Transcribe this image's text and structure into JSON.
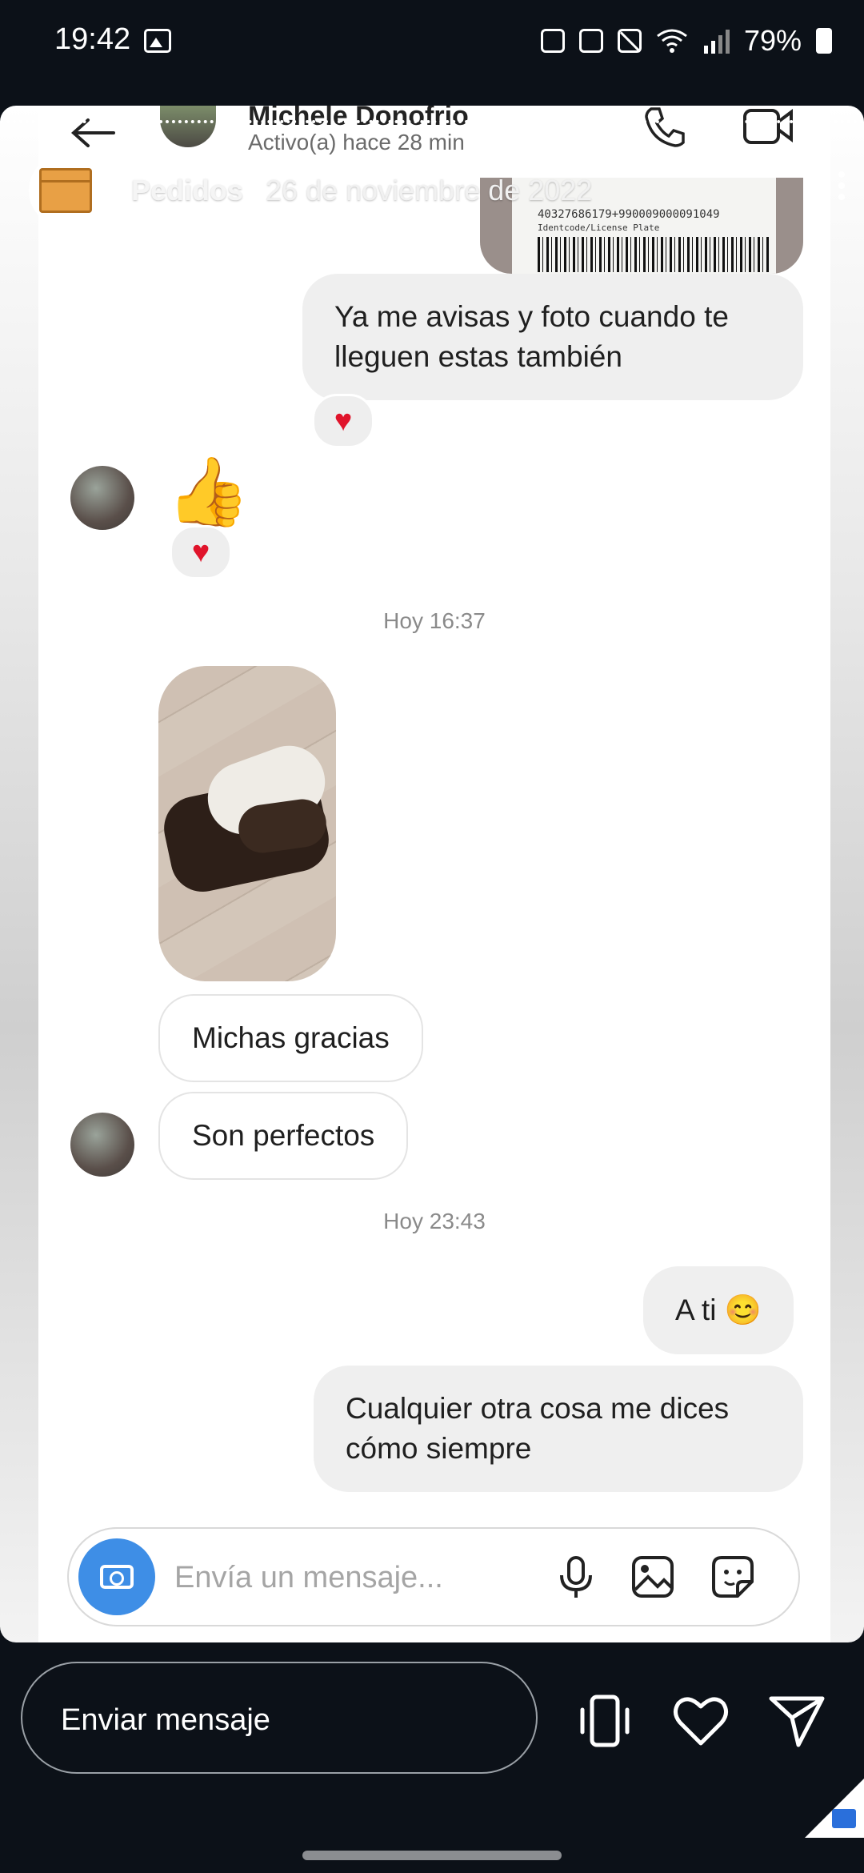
{
  "status_bar": {
    "time": "19:42",
    "battery": "79%"
  },
  "story": {
    "account_name": "Pedidos",
    "date": "26 de noviembre de 2022"
  },
  "chat": {
    "contact_name": "Michele Donofrio",
    "contact_status": "Activo(a) hace 28 min",
    "label_text": "40327686179+990009000091049",
    "label_subtext": "Identcode/License Plate",
    "messages": {
      "sent_1": "Ya me avisas y foto cuando te lleguen estas también",
      "timestamp_1": "Hoy 16:37",
      "recv_1": "Michas gracias",
      "recv_2": "Son perfectos",
      "timestamp_2": "Hoy 23:43",
      "sent_2": "A ti 😊",
      "sent_3": "Cualquier otra cosa me dices cómo siempre"
    },
    "reaction": "♥",
    "thumbs_emoji": "👍",
    "composer_placeholder": "Envía un mensaje..."
  },
  "bottom_bar": {
    "reply_placeholder": "Enviar mensaje"
  },
  "colors": {
    "accent_blue": "#3e8ee6",
    "heart_red": "#e0142b",
    "background": "#0c1118"
  }
}
